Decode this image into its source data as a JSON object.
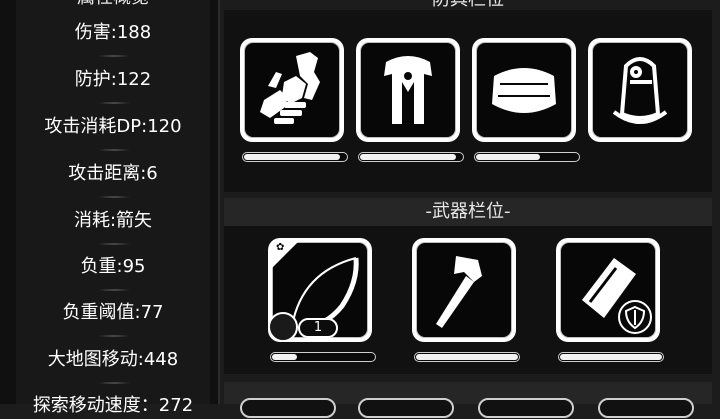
{
  "stats_panel": {
    "header": "属性概览",
    "rows": [
      {
        "label": "伤害:188"
      },
      {
        "label": "防护:122"
      },
      {
        "label": "攻击消耗DP:120"
      },
      {
        "label": "攻击距离:6"
      },
      {
        "label": "消耗:箭矢"
      },
      {
        "label": "负重:95"
      },
      {
        "label": "负重阈值:77"
      },
      {
        "label": "大地图移动:448"
      },
      {
        "label": "探索移动速度：272"
      }
    ]
  },
  "equipment_section": {
    "header": "防具栏位",
    "slots": [
      {
        "icon": "gauntlet-icon",
        "durability": 0.95
      },
      {
        "icon": "fur-robe-icon",
        "durability": 0.95
      },
      {
        "icon": "fur-hat-icon",
        "durability": 0.66
      },
      {
        "icon": "backpack-icon",
        "durability": 0.0
      }
    ]
  },
  "weapon_section": {
    "header": "-武器栏位-",
    "slots": [
      {
        "icon": "bow-icon",
        "durability": 0.25,
        "ammo_count": "1",
        "badge": "beast-paw-icon"
      },
      {
        "icon": "war-axe-icon",
        "durability": 1.0
      },
      {
        "icon": "shield-case-icon",
        "durability": 1.0,
        "badge": "shield-icon"
      }
    ]
  },
  "colors": {
    "background": "#1c1c1c",
    "panel": "#111111",
    "slot_frame": "#ffffff",
    "slot_inner": "#070707",
    "text": "#ffffff"
  }
}
